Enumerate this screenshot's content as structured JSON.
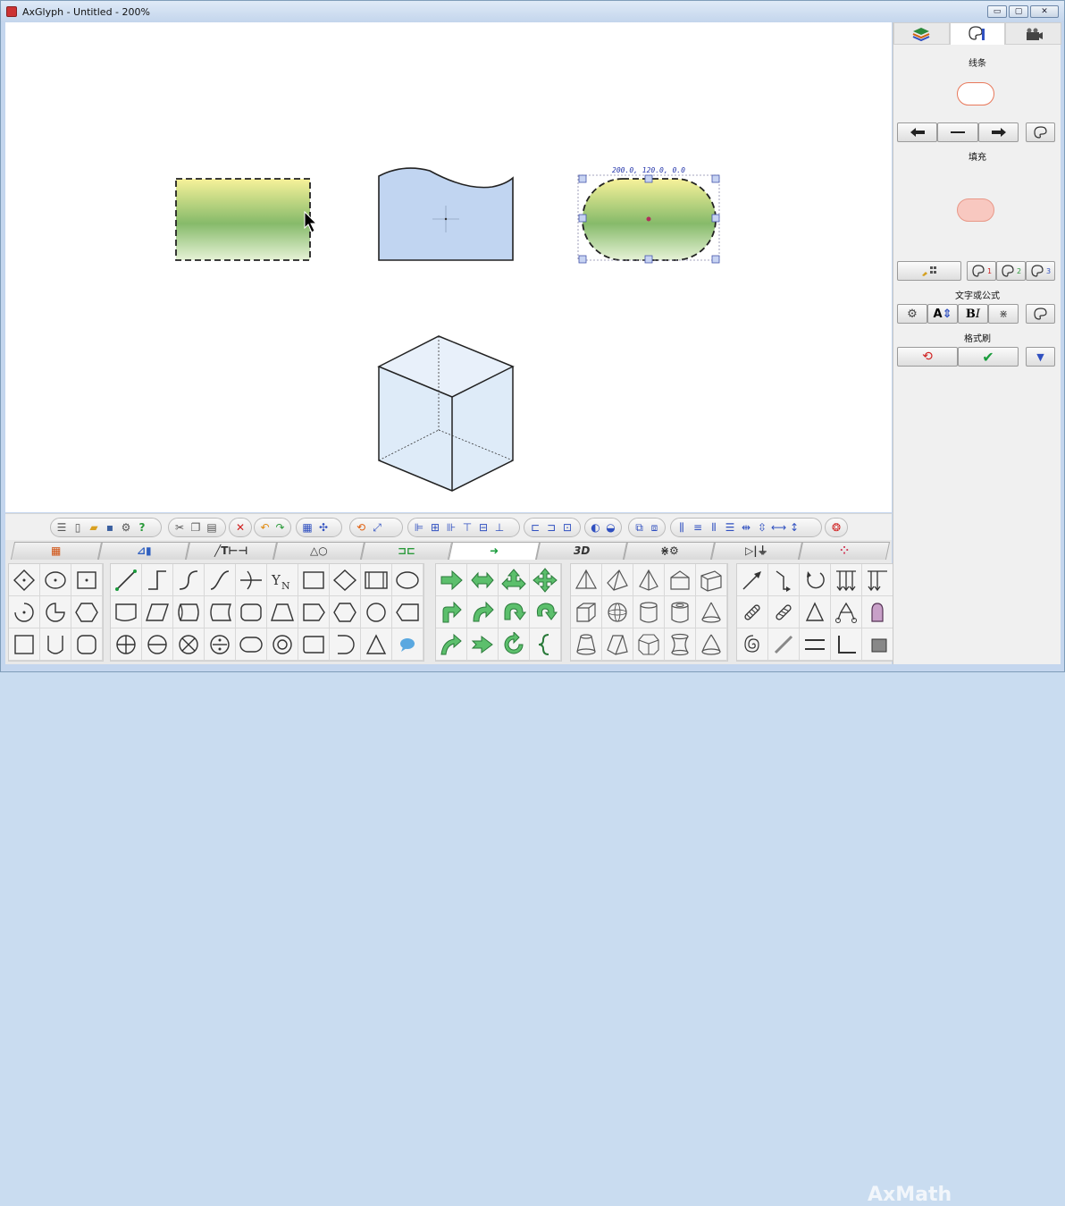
{
  "window": {
    "title": "AxGlyph - Untitled - 200%",
    "controls": [
      "minimize",
      "maximize",
      "close"
    ]
  },
  "canvas": {
    "selection_label": "200.0, 120.0, 0.0"
  },
  "side_panel": {
    "tabs": [
      "layers-icon",
      "style-icon",
      "camera-icon"
    ],
    "line_section": "线条",
    "fill_section": "填充",
    "text_section": "文字或公式",
    "format_brush_section": "格式刷",
    "line_color": "#e8785a",
    "fill_color": "#f8c8c0",
    "fill_border": "#e89888",
    "palette_buttons": [
      "1",
      "2",
      "3"
    ]
  },
  "bottom_tabs": [
    "chart-icon",
    "line-text-icon",
    "shape-icon",
    "connector-icon",
    "arrow-icon",
    "3D",
    "misc-icon",
    "circuit-icon",
    "grid-icon"
  ],
  "active_tab": "arrow-icon",
  "watermark": "AxMath",
  "accent": "#1a9c3c"
}
